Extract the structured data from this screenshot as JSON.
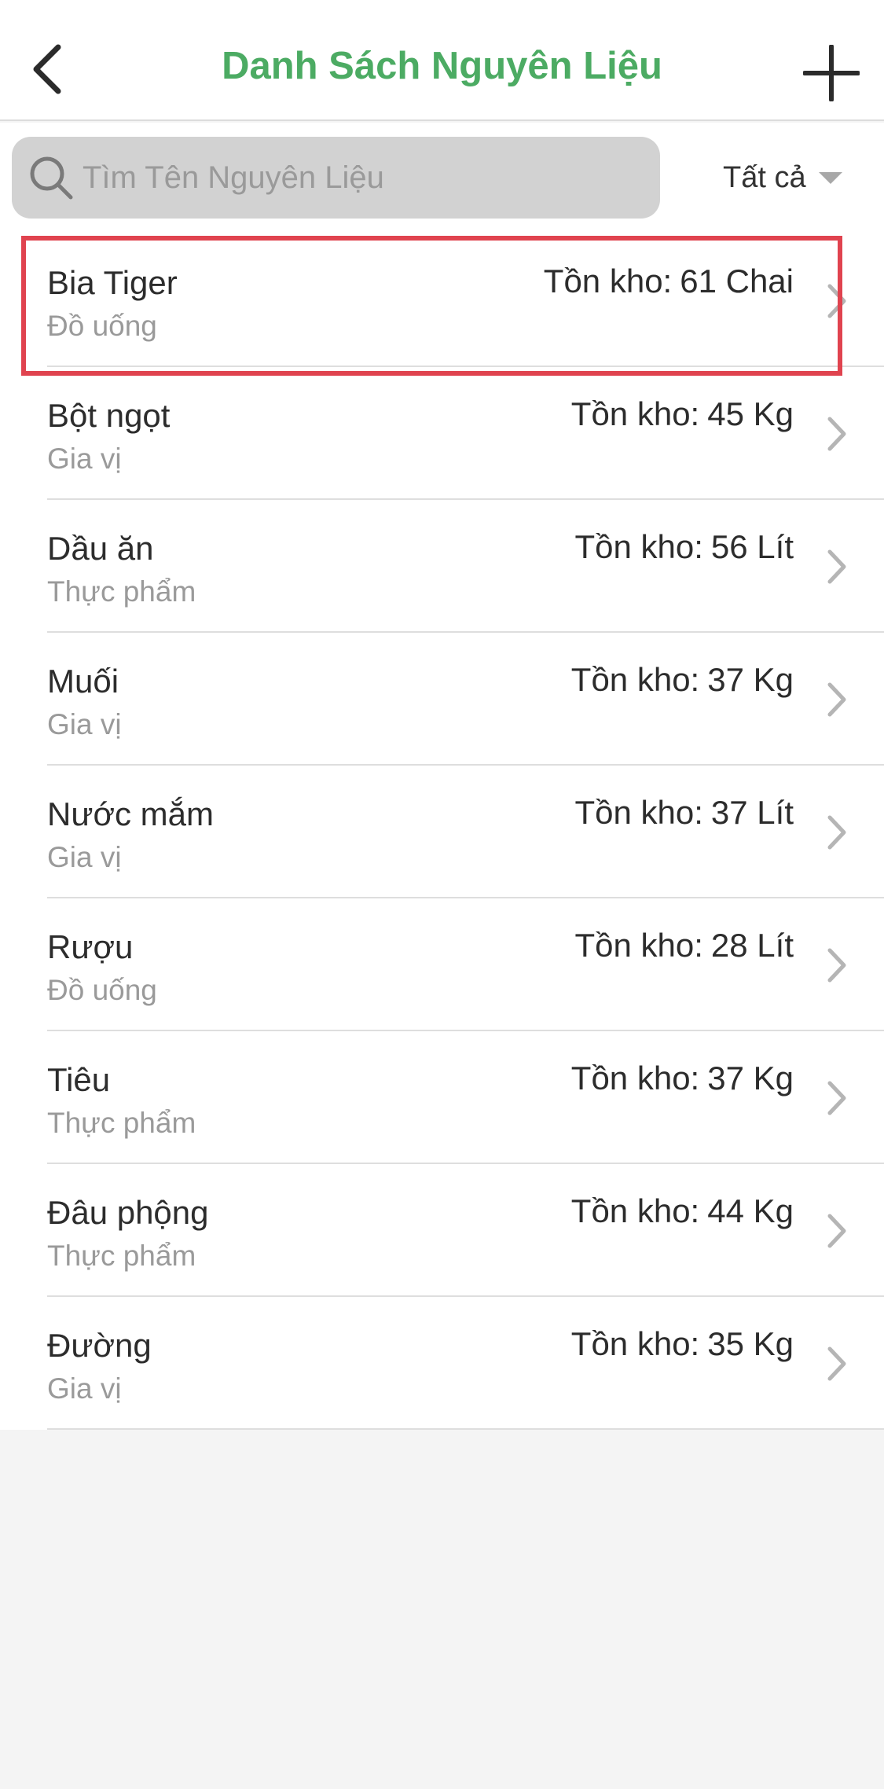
{
  "header": {
    "title": "Danh Sách Nguyên Liệu",
    "back_icon": "chevron-left-icon",
    "add_icon": "plus-icon"
  },
  "search": {
    "placeholder": "Tìm Tên Nguyên Liệu",
    "value": "",
    "icon": "search-icon"
  },
  "filter": {
    "selected": "Tất cả"
  },
  "colors": {
    "accent_green": "#4cab63",
    "highlight_red": "#e0434f",
    "search_bg": "#d2d2d2",
    "page_bg": "#f4f4f4"
  },
  "stock_label": "Tồn kho:",
  "items": [
    {
      "name": "Bia Tiger",
      "category": "Đồ uống",
      "stock": "61 Chai",
      "highlighted": true
    },
    {
      "name": "Bột ngọt",
      "category": "Gia vị",
      "stock": "45 Kg"
    },
    {
      "name": "Dầu ăn",
      "category": "Thực phẩm",
      "stock": "56 Lít"
    },
    {
      "name": "Muối",
      "category": "Gia vị",
      "stock": "37 Kg"
    },
    {
      "name": "Nước mắm",
      "category": "Gia vị",
      "stock": "37 Lít"
    },
    {
      "name": "Rượu",
      "category": "Đồ uống",
      "stock": "28 Lít"
    },
    {
      "name": "Tiêu",
      "category": "Thực phẩm",
      "stock": "37 Kg"
    },
    {
      "name": "Đâu phộng",
      "category": "Thực phẩm",
      "stock": "44 Kg"
    },
    {
      "name": "Đường",
      "category": "Gia vị",
      "stock": "35 Kg"
    }
  ]
}
